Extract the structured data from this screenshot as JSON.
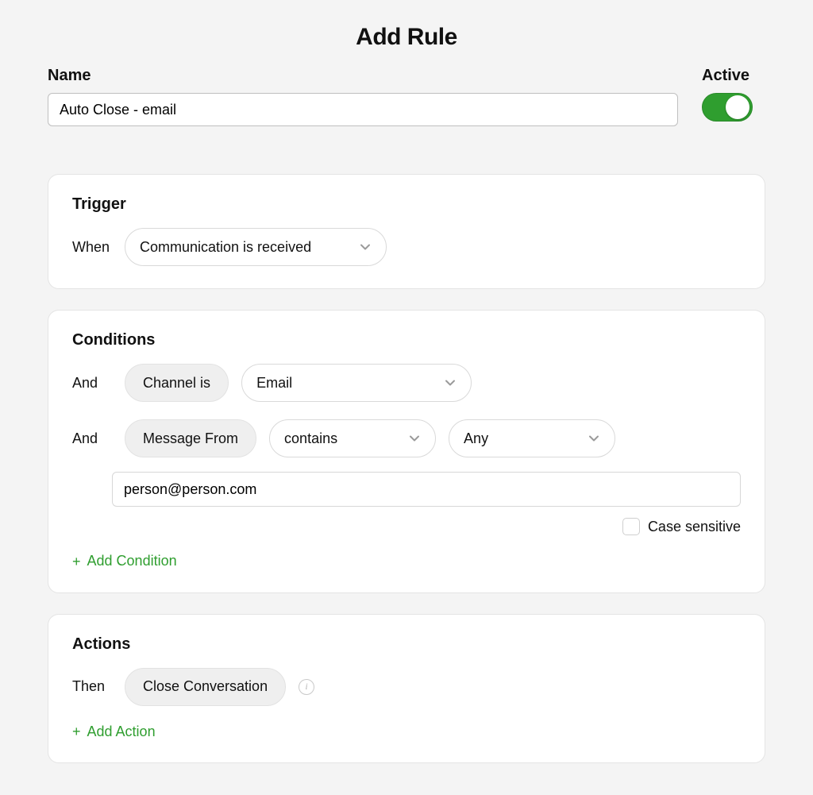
{
  "title": "Add Rule",
  "name": {
    "label": "Name",
    "value": "Auto Close - email"
  },
  "active": {
    "label": "Active",
    "on": true
  },
  "trigger": {
    "heading": "Trigger",
    "lead": "When",
    "event": "Communication is received"
  },
  "conditions": {
    "heading": "Conditions",
    "rows": [
      {
        "lead": "And",
        "chip": "Channel is",
        "value": "Email"
      },
      {
        "lead": "And",
        "chip": "Message From",
        "operator": "contains",
        "scope": "Any",
        "text": "person@person.com"
      }
    ],
    "case_sensitive_label": "Case sensitive",
    "add_label": "Add Condition"
  },
  "actions": {
    "heading": "Actions",
    "lead": "Then",
    "chip": "Close Conversation",
    "add_label": "Add Action"
  }
}
